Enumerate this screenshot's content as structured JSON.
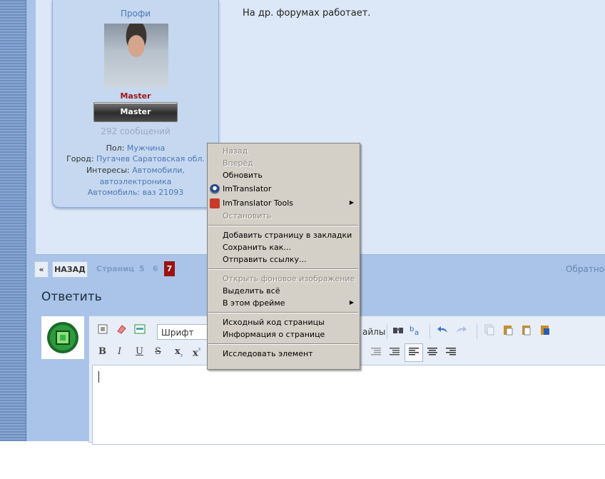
{
  "profile": {
    "rank_title": "Профи",
    "user_name": "Master",
    "rank_badge": "Master",
    "message_count": "292 сообщений",
    "gender_label": "Пол:",
    "gender_value": "Мужчина",
    "city_label": "Город:",
    "city_value": "Пугачев Саратовская обл.",
    "interests_label": "Интересы:",
    "interests_value_1": "Автомобили,",
    "interests_value_2": "автоэлектроника",
    "car_label": "Автомобиль:",
    "car_value": "ваз 21093"
  },
  "post": {
    "text": "На др. форумах работает."
  },
  "pagination": {
    "prev": "«",
    "back": "НАЗАД",
    "pages_label": "Страниц",
    "page_5": "5",
    "page_6": "6",
    "page_current": "7",
    "back_to_top": "Обратно в"
  },
  "reply": {
    "heading": "Ответить"
  },
  "editor": {
    "font_placeholder": "Шрифт",
    "files_label": "айлы",
    "bold": "B",
    "italic": "I",
    "underline": "U",
    "strike": "S",
    "subscript": "x",
    "superscript": "x"
  },
  "context_menu": {
    "back": "Назад",
    "forward": "Вперёд",
    "reload": "Обновить",
    "imtranslator": "ImTranslator",
    "imtranslator_tools": "ImTranslator Tools",
    "stop": "Остановить",
    "bookmark": "Добавить страницу в закладки",
    "save_as": "Сохранить как...",
    "send_link": "Отправить ссылку...",
    "open_bg_image": "Открыть фоновое изображение",
    "select_all": "Выделить всё",
    "this_frame": "В этом фрейме",
    "view_source": "Исходный код страницы",
    "page_info": "Информация о странице",
    "inspect": "Исследовать элемент"
  },
  "colors": {
    "page_bg": "#a7c2e6",
    "accent_red": "#9b1212",
    "link_blue": "#4a78b5",
    "menu_bg": "#d4d0c8"
  }
}
